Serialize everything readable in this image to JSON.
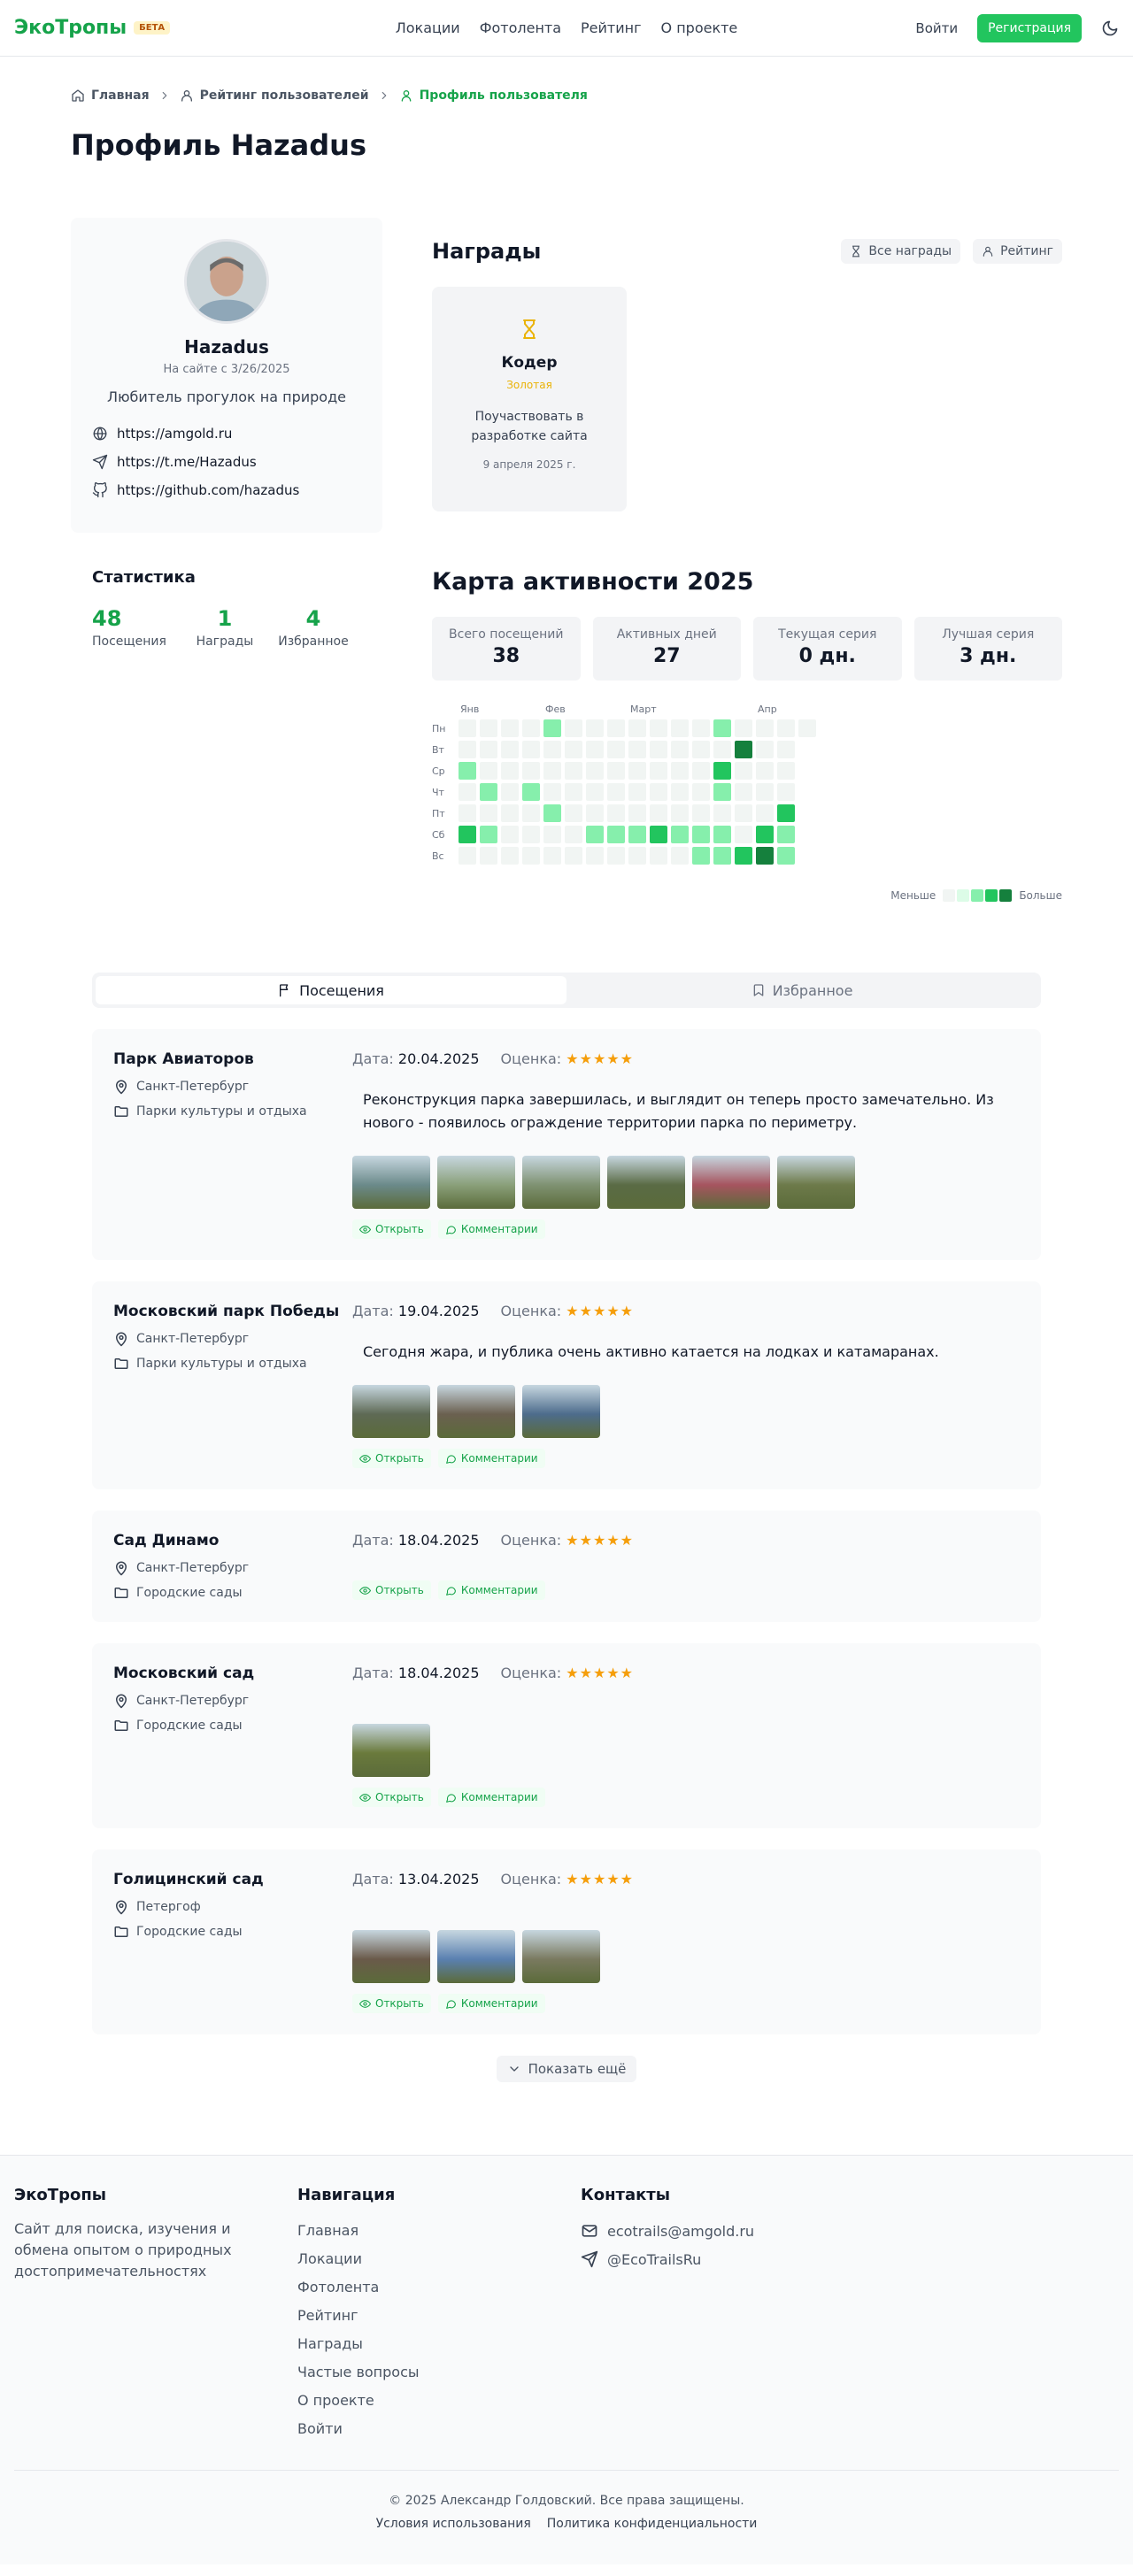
{
  "header": {
    "logo": "ЭкоТропы",
    "badge": "БЕТА",
    "nav": [
      "Локации",
      "Фотолента",
      "Рейтинг",
      "О проекте"
    ],
    "login": "Войти",
    "register": "Регистрация"
  },
  "breadcrumb": [
    "Главная",
    "Рейтинг пользователей",
    "Профиль пользователя"
  ],
  "page_title": "Профиль Hazadus",
  "profile": {
    "name": "Hazadus",
    "since": "На сайте с 3/26/2025",
    "bio": "Любитель прогулок на природе",
    "links": [
      "https://amgold.ru",
      "https://t.me/Hazadus",
      "https://github.com/hazadus"
    ]
  },
  "awards": {
    "title": "Награды",
    "all_button": "Все награды",
    "rating_button": "Рейтинг",
    "items": [
      {
        "title": "Кодер",
        "level": "Золотая",
        "desc": "Поучаствовать в разработке сайта",
        "date": "9 апреля 2025 г."
      }
    ]
  },
  "stats": {
    "title": "Статистика",
    "items": [
      {
        "value": "48",
        "label": "Посещения"
      },
      {
        "value": "1",
        "label": "Награды"
      },
      {
        "value": "4",
        "label": "Избранное"
      }
    ]
  },
  "activity": {
    "title": "Карта активности 2025",
    "summary": [
      {
        "label": "Всего посещений",
        "value": "38"
      },
      {
        "label": "Активных дней",
        "value": "27"
      },
      {
        "label": "Текущая серия",
        "value": "0 дн."
      },
      {
        "label": "Лучшая серия",
        "value": "3 дн."
      }
    ],
    "months": [
      "Янв",
      "Фев",
      "Март",
      "Апр"
    ],
    "days": [
      "Пн",
      "Вт",
      "Ср",
      "Чт",
      "Пт",
      "Сб",
      "Вс"
    ],
    "legend_less": "Меньше",
    "legend_more": "Больше",
    "colors": [
      "#f1f5f3",
      "#dcfce7",
      "#86efac",
      "#22c55e",
      "#15803d"
    ],
    "grid": [
      [
        0,
        0,
        0,
        0,
        2,
        0,
        0,
        0,
        0,
        0,
        0,
        0,
        2,
        0,
        0,
        0,
        0
      ],
      [
        0,
        0,
        0,
        0,
        0,
        0,
        0,
        0,
        0,
        0,
        0,
        0,
        0,
        4,
        0,
        0,
        -1
      ],
      [
        2,
        0,
        0,
        0,
        0,
        0,
        0,
        0,
        0,
        0,
        0,
        0,
        3,
        0,
        0,
        0,
        -1
      ],
      [
        0,
        2,
        0,
        2,
        0,
        0,
        0,
        0,
        0,
        0,
        0,
        0,
        2,
        0,
        0,
        0,
        -1
      ],
      [
        0,
        0,
        0,
        0,
        2,
        0,
        0,
        0,
        0,
        0,
        0,
        0,
        0,
        0,
        0,
        3,
        -1
      ],
      [
        3,
        2,
        0,
        0,
        0,
        0,
        2,
        2,
        2,
        3,
        2,
        2,
        2,
        0,
        3,
        2,
        -1
      ],
      [
        0,
        0,
        0,
        0,
        0,
        0,
        0,
        0,
        0,
        0,
        0,
        2,
        2,
        3,
        4,
        2,
        -1
      ]
    ]
  },
  "tabs": [
    "Посещения",
    "Избранное"
  ],
  "visit_labels": {
    "date": "Дата:",
    "rating": "Оценка:",
    "open": "Открыть",
    "comments": "Комментарии"
  },
  "visits": [
    {
      "name": "Парк Авиаторов",
      "city": "Санкт-Петербург",
      "category": "Парки культуры и отдыха",
      "date": "20.04.2025",
      "stars": "★★★★★",
      "text": "Реконструкция парка завершилась, и выглядит он теперь просто замечательно. Из нового - появилось ограждение территории парка по периметру.",
      "photos": [
        "#6b8a8a",
        "#8aa07a",
        "#7f9272",
        "#5a6b45",
        "#a6545f",
        "#6d7a4a"
      ]
    },
    {
      "name": "Московский парк Победы",
      "city": "Санкт-Петербург",
      "category": "Парки культуры и отдыха",
      "date": "19.04.2025",
      "stars": "★★★★★",
      "text": "Сегодня жара, и публика очень активно катается на лодках и катамаранах.",
      "photos": [
        "#5e6a55",
        "#6b6050",
        "#4d6c8c"
      ]
    },
    {
      "name": "Сад Динамо",
      "city": "Санкт-Петербург",
      "category": "Городские сады",
      "date": "18.04.2025",
      "stars": "★★★★★",
      "text": "",
      "photos": []
    },
    {
      "name": "Московский сад",
      "city": "Санкт-Петербург",
      "category": "Городские сады",
      "date": "18.04.2025",
      "stars": "★★★★★",
      "text": "",
      "photos": [
        "#6a7a3c"
      ]
    },
    {
      "name": "Голицинский сад",
      "city": "Петергоф",
      "category": "Городские сады",
      "date": "13.04.2025",
      "stars": "★★★★★",
      "text": "",
      "photos": [
        "#6a5a4a",
        "#5a80b0",
        "#7a7a60"
      ]
    }
  ],
  "show_more": "Показать ещё",
  "footer": {
    "brand": "ЭкоТропы",
    "about": "Сайт для поиска, изучения и обмена опытом о природных достопримечательностях",
    "nav_title": "Навигация",
    "nav": [
      "Главная",
      "Локации",
      "Фотолента",
      "Рейтинг",
      "Награды",
      "Частые вопросы",
      "О проекте",
      "Войти"
    ],
    "contacts_title": "Контакты",
    "email": "ecotrails@amgold.ru",
    "telegram": "@EcoTrailsRu",
    "copyright": "© 2025 Александр Голдовский. Все права защищены.",
    "terms": "Условия использования",
    "privacy": "Политика конфиденциальности"
  }
}
